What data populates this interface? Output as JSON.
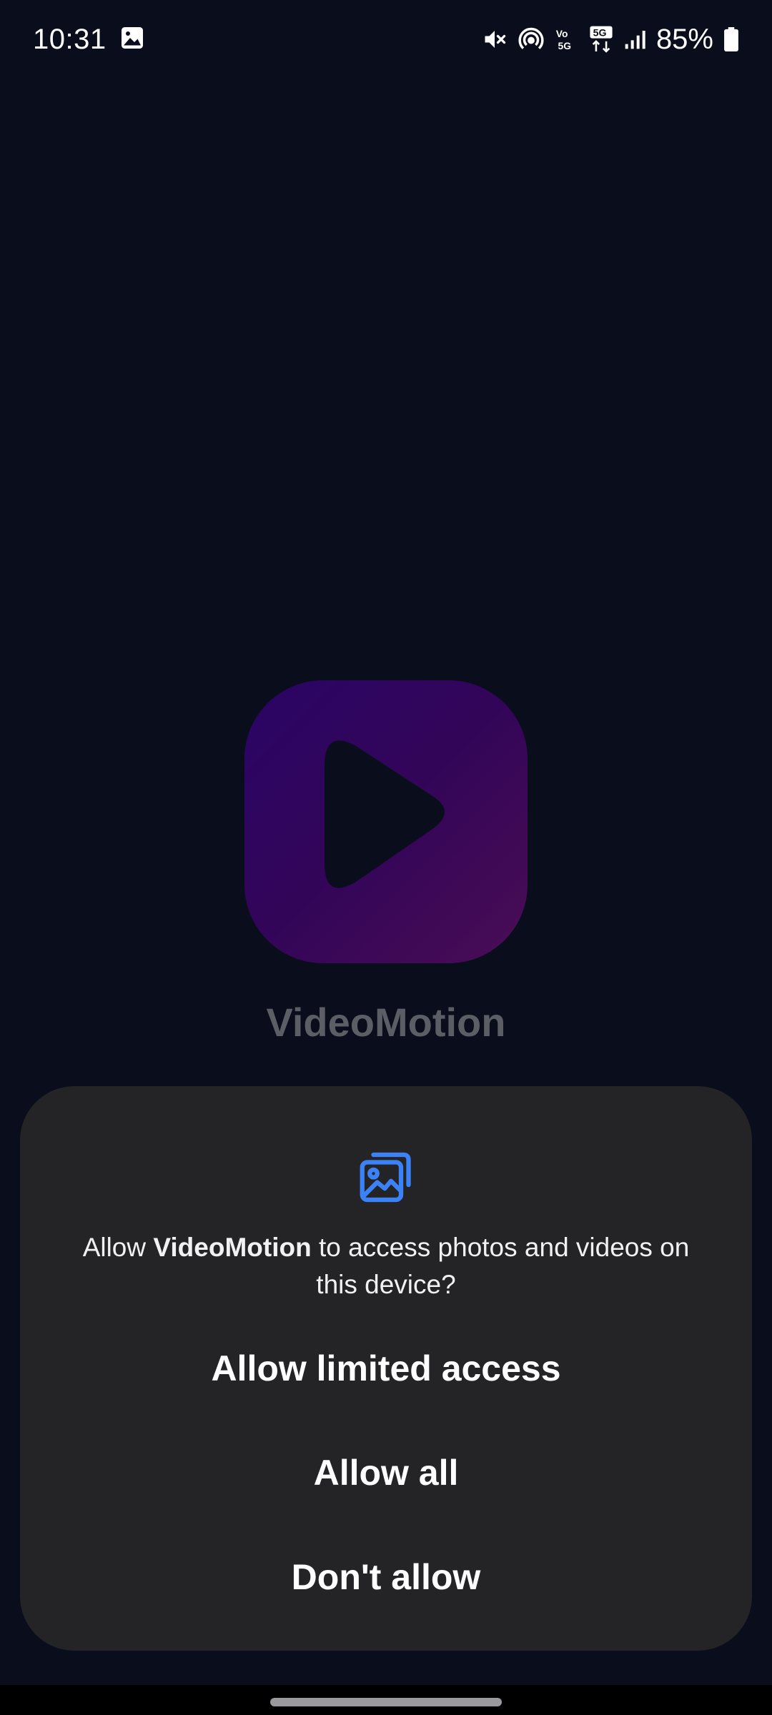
{
  "status_bar": {
    "time": "10:31",
    "battery": "85%",
    "icons": [
      "image-icon",
      "mute-icon",
      "hotspot-icon",
      "volte-icon",
      "5g-icon",
      "signal-icon",
      "battery-icon"
    ]
  },
  "app": {
    "name": "VideoMotion",
    "logo_gradient": [
      "#2a0566",
      "#4a0d55"
    ],
    "background": "#0a0e1c"
  },
  "dialog": {
    "message_prefix": "Allow ",
    "app_name": "VideoMotion",
    "message_suffix": " to access photos and videos on this device?",
    "buttons": {
      "limited": "Allow limited access",
      "all": "Allow all",
      "deny": "Don't allow"
    },
    "icon": "photos-icon",
    "accent": "#3b82f6",
    "background": "#242427"
  }
}
